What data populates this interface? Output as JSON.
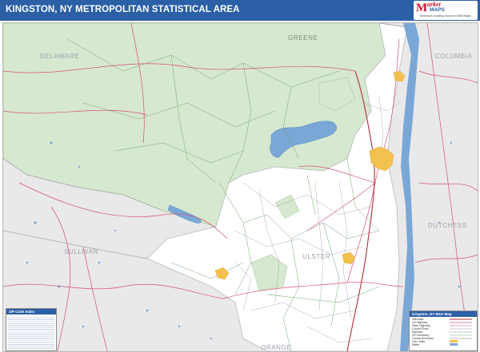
{
  "title": "KINGSTON, NY METROPOLITAN STATISTICAL AREA",
  "logo": {
    "mark": "M",
    "line1": "arket",
    "line2": "MAPS",
    "tagline": "America's Leading Source of Wall Maps"
  },
  "counties": {
    "delaware": "DELAWARE",
    "greene": "GREENE",
    "columbia": "COLUMBIA",
    "dutchess": "DUTCHESS",
    "sullivan": "SULLIVAN",
    "ulster": "ULSTER",
    "orange": "ORANGE"
  },
  "zip_table": {
    "title": "ZIP Code Index"
  },
  "legend": {
    "title": "Kingston, NY MSA Map",
    "items": [
      "Interstate",
      "US Highway",
      "State Highway",
      "County Road",
      "Railroad",
      "ZIP Boundary",
      "County Boundary",
      "City Limits",
      "Water"
    ]
  },
  "colors": {
    "header": "#2b5fa6",
    "msa_fill": "#ffffff",
    "greene_fill": "#d6e8cf",
    "outside_fill": "#e9e9e9",
    "water": "#7aa7d6",
    "road": "#d5507a",
    "city": "#f2c14e"
  }
}
